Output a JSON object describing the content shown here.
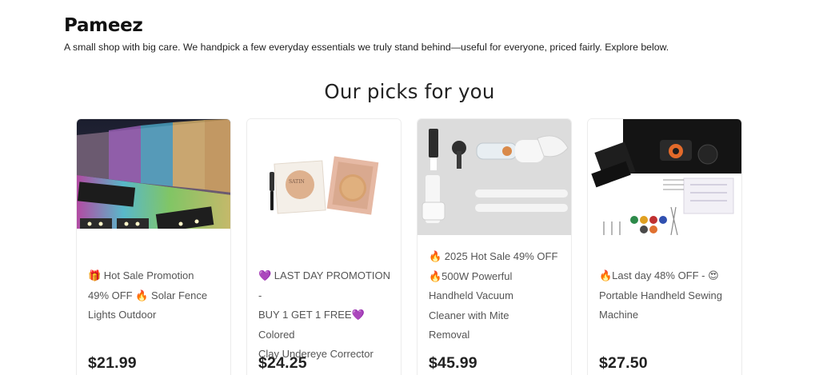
{
  "shop": {
    "name": "Pameez",
    "tagline": "A small shop with big care. We handpick a few everyday essentials we truly stand behind—useful for everyone, priced fairly. Explore below."
  },
  "section": {
    "title": "Our picks for you"
  },
  "products": [
    {
      "title_lines": [
        "🎁 Hot Sale Promotion",
        "49% OFF 🔥 Solar Fence",
        "Lights Outdoor"
      ],
      "price": "$21.99",
      "image": "solar-fence-lights-image"
    },
    {
      "title_lines": [
        "💜 LAST DAY PROMOTION -",
        "BUY 1 GET 1 FREE💜 Colored",
        "Clay Undereye Corrector"
      ],
      "price": "$24.25",
      "image": "undereye-corrector-image"
    },
    {
      "title_lines": [
        "🔥 2025 Hot Sale 49% OFF",
        "🔥500W Powerful",
        "Handheld Vacuum",
        "Cleaner with Mite",
        "Removal"
      ],
      "price": "$45.99",
      "image": "handheld-vacuum-image"
    },
    {
      "title_lines": [
        "🔥Last day 48% OFF - 😍",
        "Portable Handheld Sewing",
        "Machine"
      ],
      "price": "$27.50",
      "image": "sewing-machine-image"
    }
  ],
  "colors": {
    "text": "#222222",
    "muted_text": "#555555",
    "card_border": "#ececec",
    "background": "#ffffff"
  }
}
